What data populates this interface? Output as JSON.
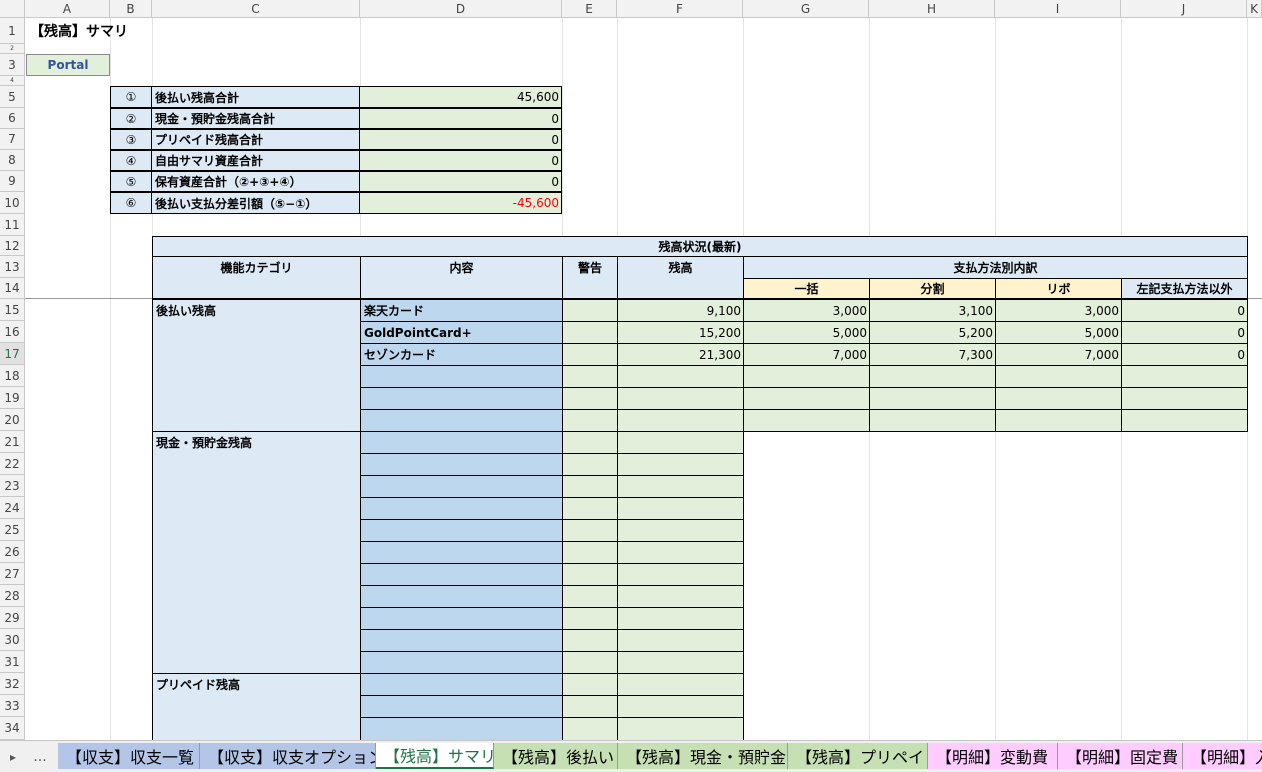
{
  "sheet": {
    "title": "【残高】サマリ",
    "portal_button": "Portal",
    "columns": [
      "A",
      "B",
      "C",
      "D",
      "E",
      "F",
      "G",
      "H",
      "I",
      "J",
      "K"
    ],
    "rows": [
      "1",
      "2",
      "3",
      "4",
      "5",
      "6",
      "7",
      "8",
      "9",
      "10",
      "11",
      "12",
      "13",
      "14",
      "15",
      "16",
      "17",
      "18",
      "19",
      "20",
      "21",
      "22",
      "23",
      "24",
      "25",
      "26",
      "27",
      "28",
      "29",
      "30",
      "31",
      "32",
      "33",
      "34"
    ],
    "active_row": "17"
  },
  "summary": {
    "items": [
      {
        "num": "①",
        "label": "後払い残高合計",
        "value": "45,600"
      },
      {
        "num": "②",
        "label": "現金・預貯金残高合計",
        "value": "0"
      },
      {
        "num": "③",
        "label": "プリペイド残高合計",
        "value": "0"
      },
      {
        "num": "④",
        "label": "自由サマリ資産合計",
        "value": "0"
      },
      {
        "num": "⑤",
        "label": "保有資産合計（②+③+④）",
        "value": "0"
      },
      {
        "num": "⑥",
        "label": "後払い支払分差引額（⑤−①）",
        "value": "-45,600"
      }
    ]
  },
  "balance_table": {
    "title": "残高状況(最新)",
    "headers": {
      "category": "機能カテゴリ",
      "content": "内容",
      "warning": "警告",
      "balance": "残高",
      "breakdown": "支払方法別内訳",
      "lump": "一括",
      "installment": "分割",
      "revolving": "リボ",
      "other": "左記支払方法以外"
    },
    "categories": {
      "postpay": "後払い残高",
      "cash": "現金・預貯金残高",
      "prepaid": "プリペイド残高"
    },
    "postpay_rows": [
      {
        "content": "楽天カード",
        "balance": "9,100",
        "lump": "3,000",
        "installment": "3,100",
        "revolving": "3,000",
        "other": "0"
      },
      {
        "content": "GoldPointCard+",
        "balance": "15,200",
        "lump": "5,000",
        "installment": "5,200",
        "revolving": "5,000",
        "other": "0"
      },
      {
        "content": "セゾンカード",
        "balance": "21,300",
        "lump": "7,000",
        "installment": "7,300",
        "revolving": "7,000",
        "other": "0"
      }
    ]
  },
  "tabs": {
    "nav_next": "▸",
    "nav_more": "...",
    "items": [
      {
        "label": "【収支】収支一覧",
        "color": "#b4c6e7"
      },
      {
        "label": "【収支】収支オプション",
        "color": "#b4c6e7"
      },
      {
        "label": "【残高】サマリ",
        "color": "#ffffff"
      },
      {
        "label": "【残高】後払い",
        "color": "#c6e0b4"
      },
      {
        "label": "【残高】現金・預貯金",
        "color": "#c6e0b4"
      },
      {
        "label": "【残高】プリペイド",
        "color": "#c6e0b4"
      },
      {
        "label": "【明細】変動費",
        "color": "#ffccff"
      },
      {
        "label": "【明細】固定費",
        "color": "#ffccff"
      },
      {
        "label": "【明細】入",
        "color": "#ffccff"
      }
    ],
    "active_index": 2
  }
}
